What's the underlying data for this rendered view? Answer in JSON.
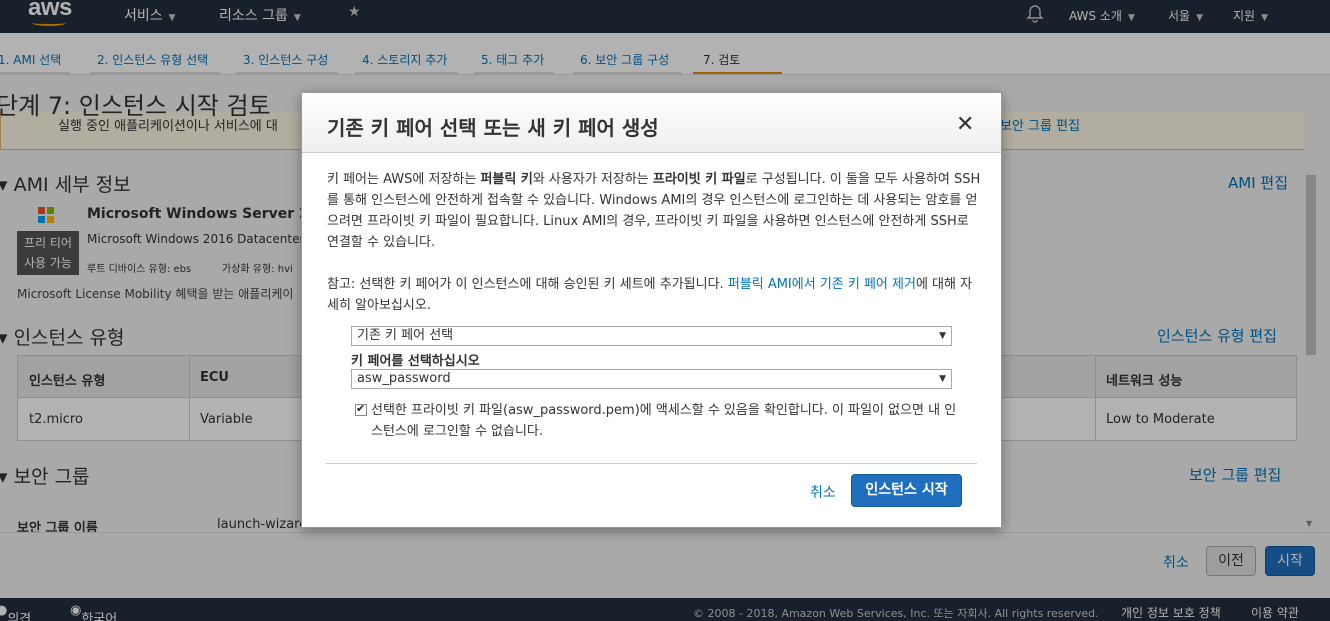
{
  "topnav": {
    "logo": "aws",
    "services": "서비스",
    "resource_groups": "리소스 그룹",
    "account": "AWS 소개",
    "region": "서울",
    "support": "지원"
  },
  "steps": [
    "1. AMI 선택",
    "2. 인스턴스 유형 선택",
    "3. 인스턴스 구성",
    "4. 스토리지 추가",
    "5. 태그 추가",
    "6. 보안 그룹 구성",
    "7. 검토"
  ],
  "page": {
    "title": "단계 7: 인스턴스 시작 검토",
    "warning_text": "실행 중인 애플리케이션이나 서비스에 대",
    "warning_link": "보안 그룹 편집"
  },
  "ami": {
    "heading": "AMI 세부 정보",
    "edit": "AMI 편집",
    "name": "Microsoft Windows Server 201",
    "free_tier": [
      "프리 티어",
      "사용 가능"
    ],
    "desc": "Microsoft Windows 2016 Datacenter",
    "root_device": "루트 디바이스 유형: ebs",
    "virt_type": "가상화 유형: hvi",
    "license": "Microsoft License Mobility 혜택을 받는 애플리케이"
  },
  "instance_type": {
    "heading": "인스턴스 유형",
    "edit": "인스턴스 유형 편집",
    "columns": [
      "인스턴스 유형",
      "ECU",
      "네트워크 성능"
    ],
    "row": [
      "t2.micro",
      "Variable",
      "Low to Moderate"
    ]
  },
  "security_group": {
    "heading": "보안 그룹",
    "edit": "보안 그룹 편집",
    "name_label": "보안 그룹 이름",
    "name_value": "launch-wizard-"
  },
  "bottom": {
    "cancel": "취소",
    "prev": "이전",
    "start": "시작"
  },
  "footer": {
    "feedback": "의견",
    "language": "한국어",
    "copyright": "© 2008 - 2018, Amazon Web Services, Inc. 또는 자회사. All rights reserved.",
    "privacy": "개인 정보 보호 정책",
    "terms": "이용 약관"
  },
  "modal": {
    "title": "기존 키 페어 선택 또는 새 키 페어 생성",
    "p1_a": "키 페어는 AWS에 저장하는 ",
    "p1_b": "퍼블릭 키",
    "p1_c": "와 사용자가 저장하는 ",
    "p1_d": "프라이빗 키 파일",
    "p1_e": "로 구성됩니다. 이 둘을 모두 사용하여 SSH를 통해 인스턴스에 안전하게 접속할 수 있습니다. Windows AMI의 경우 인스턴스에 로그인하는 데 사용되는 암호를 얻으려면 프라이빗 키 파일이 필요합니다. Linux AMI의 경우, 프라이빗 키 파일을 사용하면 인스턴스에 안전하게 SSH로 연결할 수 있습니다.",
    "p2_a": "참고: 선택한 키 페어가 이 인스턴스에 대해 승인된 키 세트에 추가됩니다. ",
    "p2_link": "퍼블릭 AMI에서 기존 키 페어 제거",
    "p2_b": "에 대해 자세히 알아보십시오.",
    "select_mode": "기존 키 페어 선택",
    "select_label": "키 페어를 선택하십시오",
    "select_key": "asw_password",
    "ack": "선택한 프라이빗 키 파일(asw_password.pem)에 액세스할 수 있음을 확인합니다. 이 파일이 없으면 내 인스턴스에 로그인할 수 없습니다.",
    "cancel": "취소",
    "launch": "인스턴스 시작"
  }
}
